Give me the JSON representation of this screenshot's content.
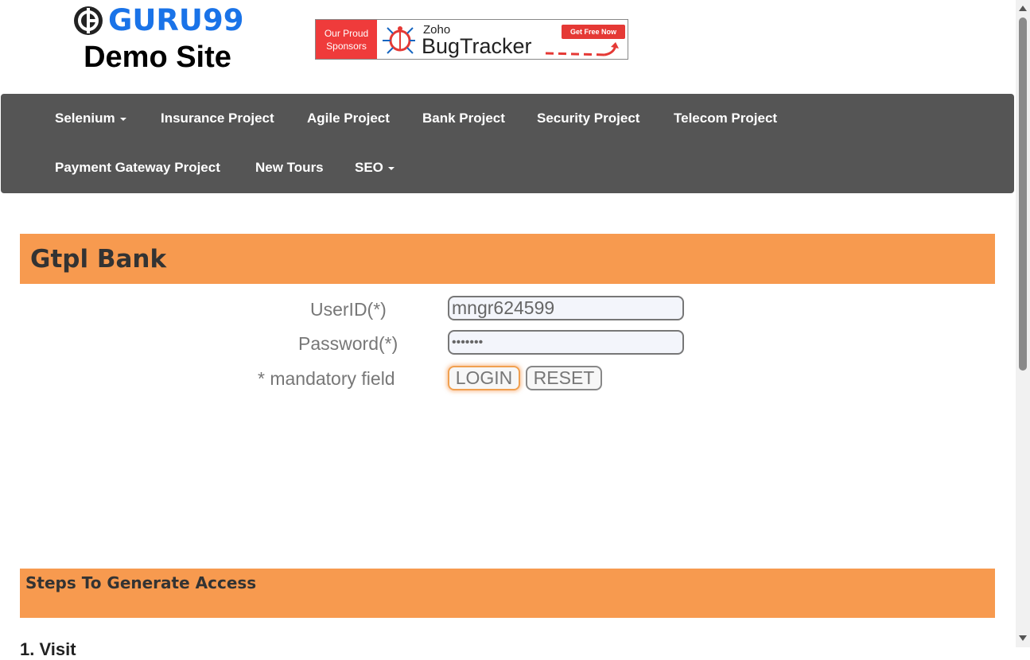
{
  "brand": {
    "logo_text": "GURU99",
    "site_title": "Demo Site"
  },
  "sponsor": {
    "tag_line1": "Our Proud",
    "tag_line2": "Sponsors",
    "company": "Zoho",
    "product": "BugTracker",
    "cta": "Get Free Now"
  },
  "nav": {
    "items": [
      {
        "label": "Selenium",
        "dropdown": true
      },
      {
        "label": "Insurance Project"
      },
      {
        "label": "Agile Project"
      },
      {
        "label": "Bank Project"
      },
      {
        "label": "Security Project"
      },
      {
        "label": "Telecom Project"
      },
      {
        "label": "Payment Gateway Project"
      },
      {
        "label": "New Tours"
      },
      {
        "label": "SEO",
        "dropdown": true
      }
    ]
  },
  "bank": {
    "title": "Gtpl Bank"
  },
  "login_form": {
    "userid_label": "UserID(*)",
    "userid_value": "mngr624599",
    "password_label": "Password(*)",
    "password_value": "•••••••",
    "mandatory_note": "* mandatory field",
    "login_label": "LOGIN",
    "reset_label": "RESET"
  },
  "steps": {
    "title": "Steps To Generate Access",
    "first_step_partial": "1. Visit"
  },
  "colors": {
    "nav_bg": "#555555",
    "accent": "#f79a4f",
    "logo_blue": "#1a73e8"
  }
}
